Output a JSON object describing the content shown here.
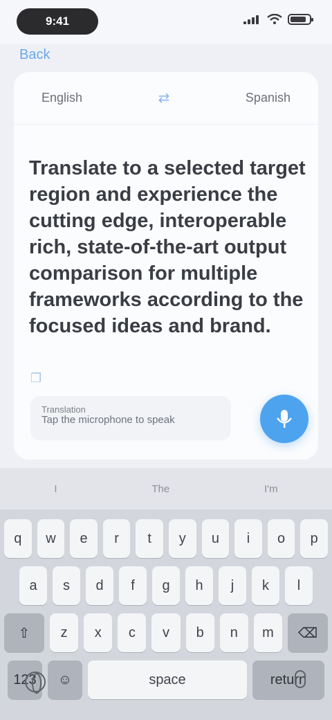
{
  "status_bar": {
    "time": "9:41"
  },
  "nav": {
    "back_label": "Back"
  },
  "languages": {
    "source": "English",
    "target": "Spanish",
    "swap_icon": "swap-icon"
  },
  "source": {
    "text": "Translate to a selected target region and experience the cutting edge, interoperable rich, state-of-the-art output comparison for multiple frameworks according to the focused ideas and brand."
  },
  "translation": {
    "label": "Translation",
    "placeholder": "Tap the microphone to speak"
  },
  "icons": {
    "copy": "copy-icon",
    "mic": "microphone-icon",
    "globe": "globe-icon",
    "dictation": "dictation-icon"
  },
  "keyboard": {
    "suggestions": [
      "I",
      "The",
      "I'm"
    ],
    "row1": [
      "q",
      "w",
      "e",
      "r",
      "t",
      "y",
      "u",
      "i",
      "o",
      "p"
    ],
    "row2": [
      "a",
      "s",
      "d",
      "f",
      "g",
      "h",
      "j",
      "k",
      "l"
    ],
    "row3": [
      "z",
      "x",
      "c",
      "v",
      "b",
      "n",
      "m"
    ],
    "shift": "⇧",
    "backspace": "⌫",
    "numbers": "123",
    "emoji": "☺",
    "space": "space",
    "return": "return"
  },
  "colors": {
    "accent": "#4ea3ee",
    "card": "#fbfcfe",
    "keyboard": "#d3d6dd"
  }
}
